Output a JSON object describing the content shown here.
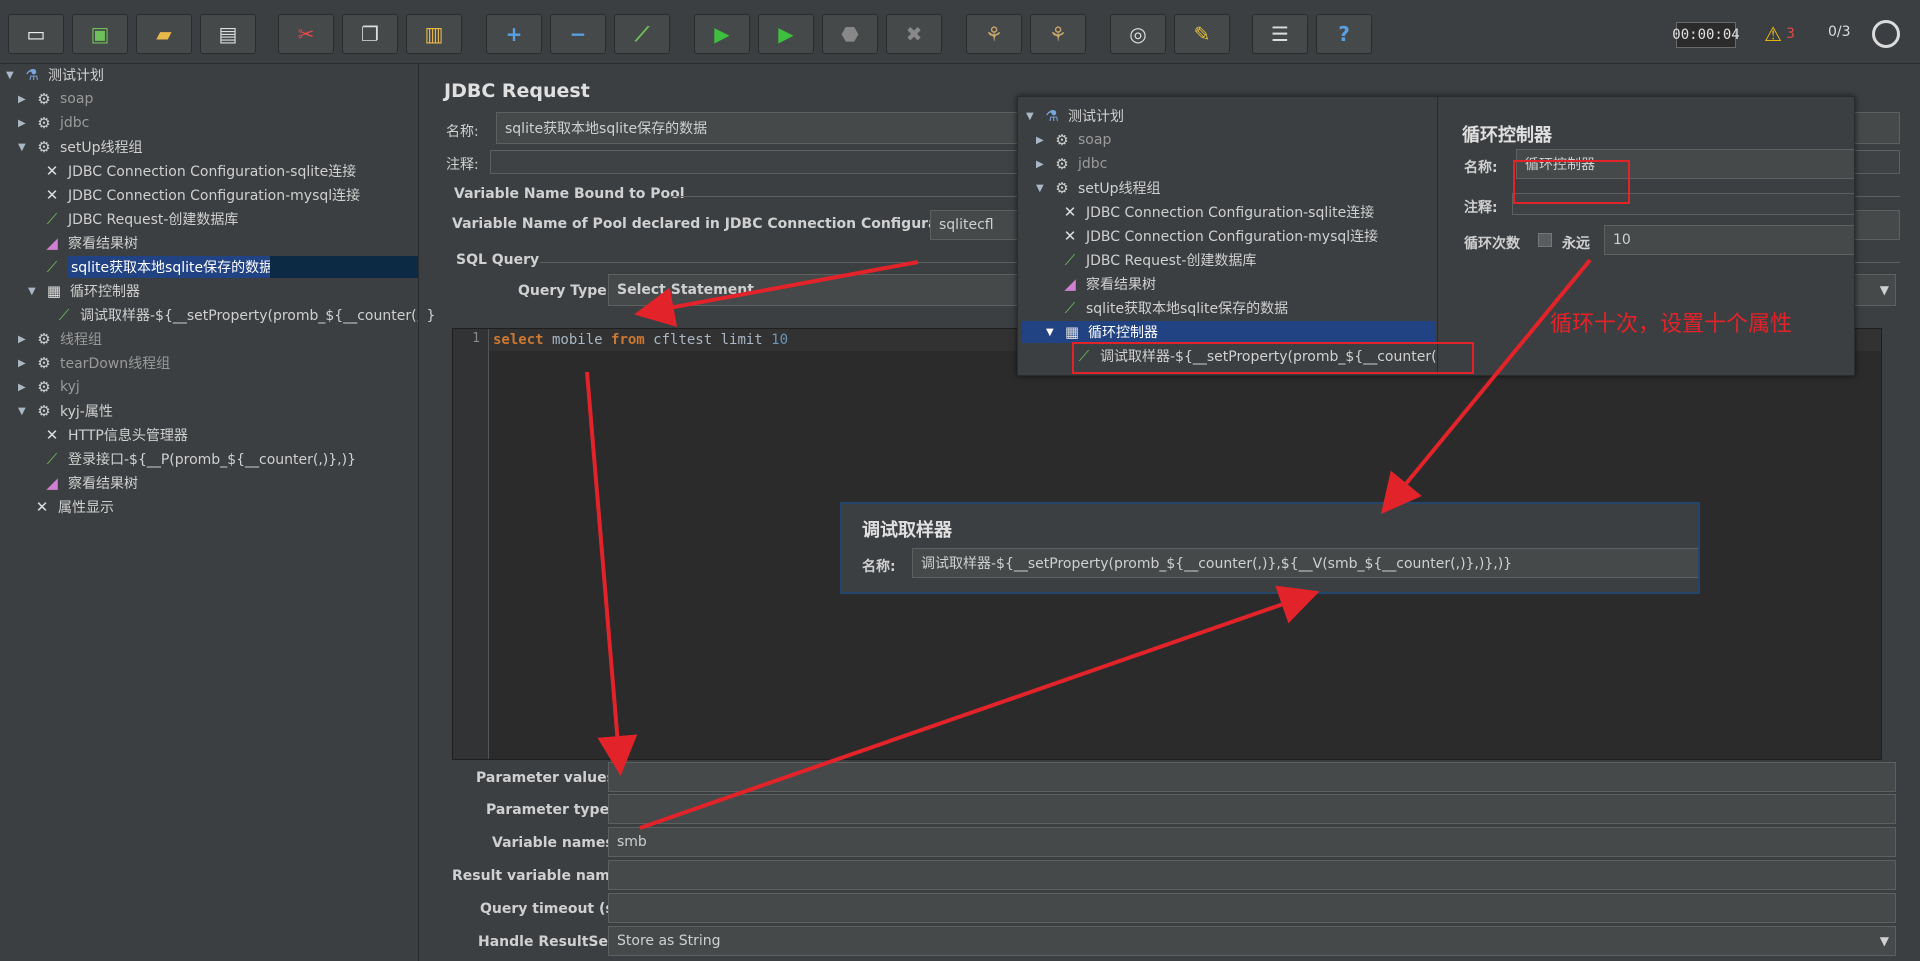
{
  "toolbar": {
    "timer": "00:00:04",
    "warn_count": "3",
    "threads": "0/3"
  },
  "tree": {
    "items": [
      {
        "label": "测试计划"
      },
      {
        "label": "soap"
      },
      {
        "label": "jdbc"
      },
      {
        "label": "setUp线程组"
      },
      {
        "label": "JDBC Connection Configuration-sqlite连接"
      },
      {
        "label": "JDBC Connection Configuration-mysql连接"
      },
      {
        "label": "JDBC Request-创建数据库"
      },
      {
        "label": "察看结果树"
      },
      {
        "label": "sqlite获取本地sqlite保存的数据"
      },
      {
        "label": "循环控制器"
      },
      {
        "label": "调试取样器-${__setProperty(promb_${__counter(,)}"
      },
      {
        "label": "线程组"
      },
      {
        "label": "tearDown线程组"
      },
      {
        "label": "kyj"
      },
      {
        "label": "kyj-属性"
      },
      {
        "label": "HTTP信息头管理器"
      },
      {
        "label": "登录接口-${__P(promb_${__counter(,)},)}"
      },
      {
        "label": "察看结果树"
      },
      {
        "label": "属性显示"
      }
    ]
  },
  "main": {
    "title": "JDBC Request",
    "name_label": "名称:",
    "name_value": "sqlite获取本地sqlite保存的数据",
    "comment_label": "注释:",
    "pool_section": "Variable Name Bound to Pool",
    "pool_label": "Variable Name of Pool declared in JDBC Connection Configuration:",
    "pool_value": "sqlitecfl",
    "sql_section": "SQL Query",
    "query_type_label": "Query Type:",
    "query_type_value": "Select Statement",
    "line_number": "1",
    "code": {
      "kw1": "select",
      "t1": " mobile ",
      "kw2": "from",
      "t2": " cfltest limit ",
      "num": "10"
    },
    "param_values_label": "Parameter values:",
    "param_types_label": "Parameter types:",
    "var_names_label": "Variable names:",
    "var_names_value": "smb",
    "result_var_label": "Result variable name:",
    "query_timeout_label": "Query timeout (s):",
    "handle_rs_label": "Handle ResultSet:",
    "handle_rs_value": "Store as String"
  },
  "overlay1": {
    "tree": [
      {
        "label": "测试计划"
      },
      {
        "label": "soap"
      },
      {
        "label": "jdbc"
      },
      {
        "label": "setUp线程组"
      },
      {
        "label": "JDBC Connection Configuration-sqlite连接"
      },
      {
        "label": "JDBC Connection Configuration-mysql连接"
      },
      {
        "label": "JDBC Request-创建数据库"
      },
      {
        "label": "察看结果树"
      },
      {
        "label": "sqlite获取本地sqlite保存的数据"
      },
      {
        "label": "循环控制器"
      },
      {
        "label": "调试取样器-${__setProperty(promb_${__counter(,)}"
      }
    ],
    "panel_title": "循环控制器",
    "name_label": "名称:",
    "name_value": "循环控制器",
    "comment_label": "注释:",
    "loop_label": "循环次数",
    "forever_label": "永远",
    "loop_value": "10"
  },
  "overlay2": {
    "title": "调试取样器",
    "name_label": "名称:",
    "name_value": "调试取样器-${__setProperty(promb_${__counter(,)},${__V(smb_${__counter(,)},)},)}"
  },
  "annotation": "循环十次，设置十个属性"
}
